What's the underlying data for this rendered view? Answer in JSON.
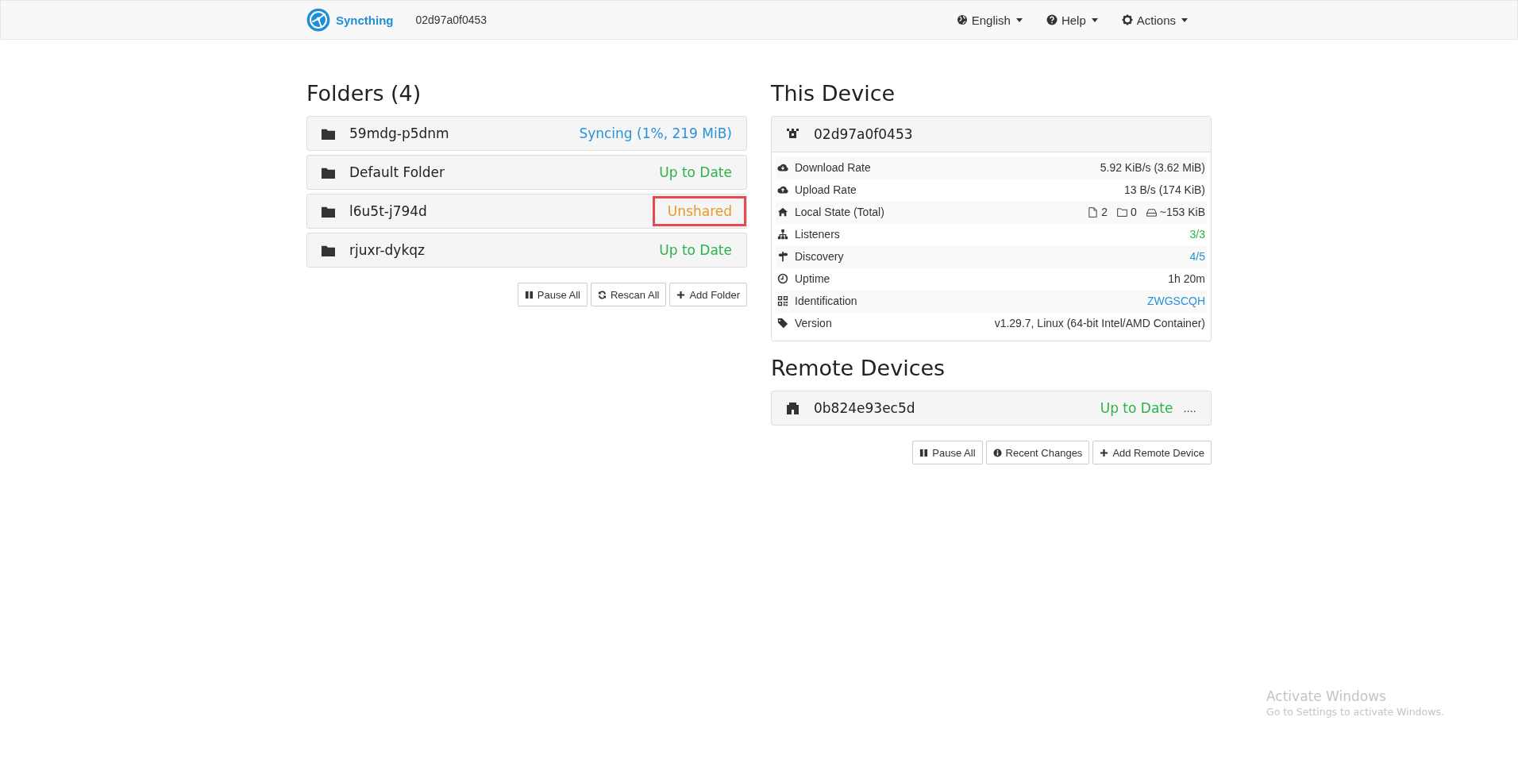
{
  "navbar": {
    "brand": "Syncthing",
    "device_name": "02d97a0f0453",
    "menus": [
      {
        "kind": "language",
        "label": "English"
      },
      {
        "kind": "help",
        "label": "Help"
      },
      {
        "kind": "actions",
        "label": "Actions"
      }
    ]
  },
  "folders": {
    "title": "Folders (4)",
    "items": [
      {
        "name": "59mdg-p5dnm",
        "status": "Syncing (1%, 219 MiB)",
        "kind": "syncing",
        "highlighted": false
      },
      {
        "name": "Default Folder",
        "status": "Up to Date",
        "kind": "idle",
        "highlighted": false
      },
      {
        "name": "l6u5t-j794d",
        "status": "Unshared",
        "kind": "unshared",
        "highlighted": true
      },
      {
        "name": "rjuxr-dykqz",
        "status": "Up to Date",
        "kind": "idle",
        "highlighted": false
      }
    ],
    "buttons": [
      {
        "kind": "pause",
        "label": "Pause All"
      },
      {
        "kind": "rescan",
        "label": "Rescan All"
      },
      {
        "kind": "add",
        "label": "Add Folder"
      }
    ]
  },
  "this_device": {
    "title": "This Device",
    "name": "02d97a0f0453",
    "rows": [
      {
        "label": "Download Rate",
        "kind": "text",
        "value": "5.92 KiB/s (3.62 MiB)"
      },
      {
        "label": "Upload Rate",
        "kind": "text",
        "value": "13 B/s (174 KiB)"
      },
      {
        "label": "Local State (Total)",
        "kind": "counts",
        "files": "2",
        "dirs": "0",
        "size": "~153 KiB"
      },
      {
        "label": "Listeners",
        "kind": "ok",
        "value": "3/3"
      },
      {
        "label": "Discovery",
        "kind": "link",
        "value": "4/5"
      },
      {
        "label": "Uptime",
        "kind": "text",
        "value": "1h 20m"
      },
      {
        "label": "Identification",
        "kind": "link",
        "value": "ZWGSCQH"
      },
      {
        "label": "Version",
        "kind": "text",
        "value": "v1.29.7, Linux (64-bit Intel/AMD Container)"
      }
    ]
  },
  "remote_devices": {
    "title": "Remote Devices",
    "items": [
      {
        "name": "0b824e93ec5d",
        "status": "Up to Date",
        "kind": "idle",
        "extra": "...."
      }
    ],
    "buttons": [
      {
        "kind": "pause",
        "label": "Pause All"
      },
      {
        "kind": "info",
        "label": "Recent Changes"
      },
      {
        "kind": "add",
        "label": "Add Remote Device"
      }
    ]
  },
  "os_notice": {
    "title": "Activate Windows",
    "text": "Go to Settings to activate Windows."
  }
}
